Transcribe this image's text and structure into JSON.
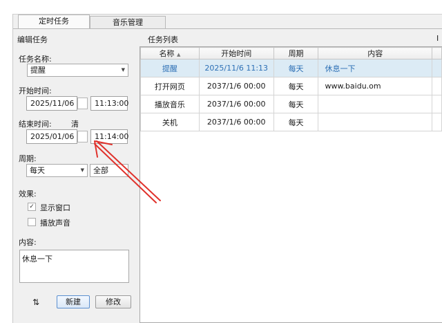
{
  "tabs": [
    {
      "label": "定时任务",
      "active": true
    },
    {
      "label": "音乐管理",
      "active": false
    }
  ],
  "left": {
    "title": "编辑任务",
    "name_label": "任务名称:",
    "name_value": "提醒",
    "start_label": "开始时间:",
    "start_date": "2025/11/06",
    "start_time": "11:13:00",
    "end_label": "结束时间:",
    "clear_label": "清",
    "end_date": "2025/01/06",
    "end_time": "11:14:00",
    "period_label": "周期:",
    "period_value": "每天",
    "period_scope": "全部",
    "effect_label": "效果:",
    "effect_show_window": "显示窗口",
    "effect_show_window_checked": true,
    "effect_play_sound": "播放声音",
    "effect_play_sound_checked": false,
    "content_label": "内容:",
    "content_value": "休息一下",
    "refresh_icon": "refresh-icon",
    "new_button": "新建",
    "modify_button": "修改"
  },
  "right": {
    "title": "任务列表",
    "edge_text": "I",
    "columns": [
      "名称",
      "开始时间",
      "周期",
      "内容"
    ],
    "sort_indicator": "▲",
    "rows": [
      {
        "name": "提醒",
        "start": "2025/11/6 11:13",
        "period": "每天",
        "content": "休息一下",
        "selected": true
      },
      {
        "name": "打开网页",
        "start": "2037/1/6 00:00",
        "period": "每天",
        "content": "www.baidu.om",
        "selected": false
      },
      {
        "name": "播放音乐",
        "start": "2037/1/6 00:00",
        "period": "每天",
        "content": "",
        "selected": false
      },
      {
        "name": "关机",
        "start": "2037/1/6 00:00",
        "period": "每天",
        "content": "",
        "selected": false
      }
    ]
  },
  "annotation": {
    "arrow_color": "#e0312b"
  },
  "colors": {
    "selected_row_bg": "#dcebf5",
    "selected_row_text": "#2c6fb5"
  }
}
